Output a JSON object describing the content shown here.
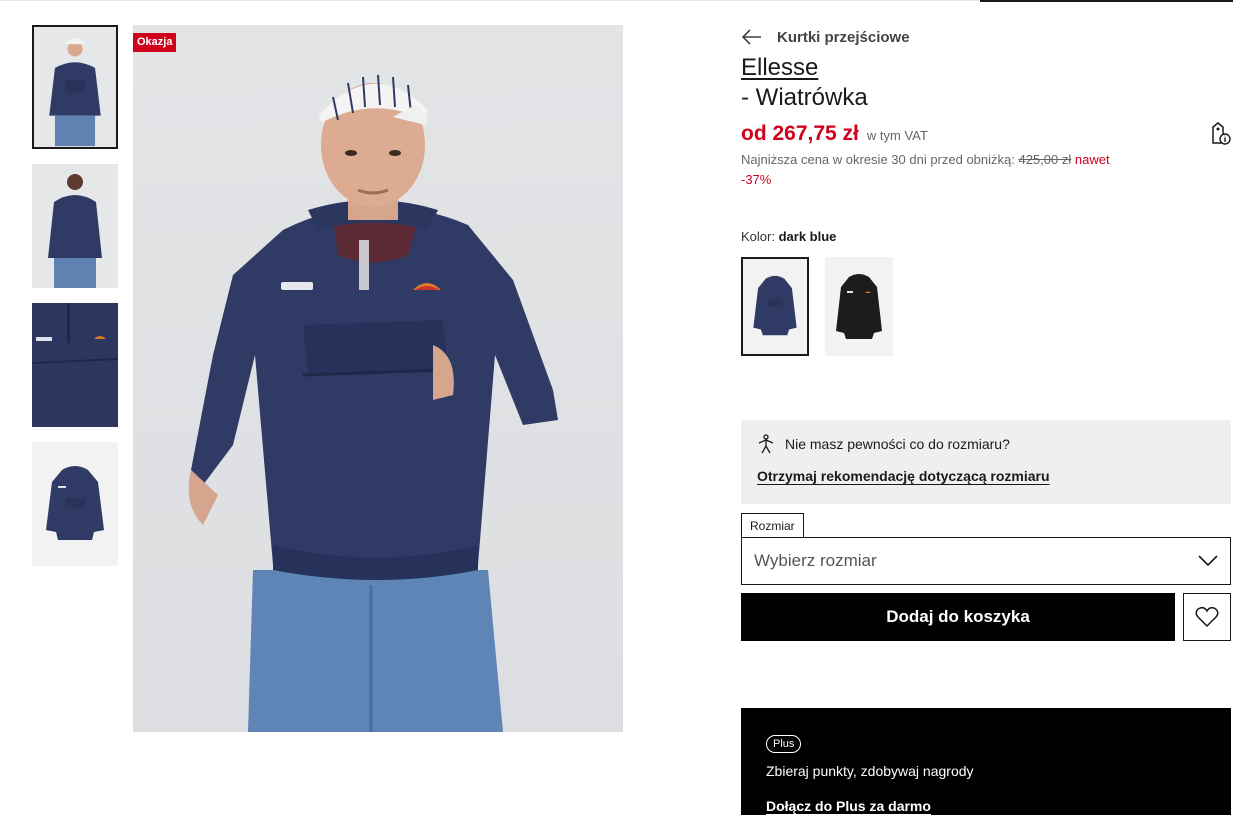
{
  "badge": "Okazja",
  "breadcrumb": {
    "label": "Kurtki przejściowe",
    "icon": "arrow-left-icon"
  },
  "product": {
    "brand": "Ellesse",
    "name": "- Wiatrówka"
  },
  "price": {
    "current": "od 267,75 zł",
    "vat_note": "w tym VAT",
    "lowest_prefix": "Najniższa cena w okresie 30 dni przed obniżką:",
    "lowest_value": "425,00 zł",
    "discount_prefix": "nawet",
    "discount": "-37%",
    "info_icon": "price-tag-info-icon"
  },
  "color": {
    "label": "Kolor:",
    "value": "dark blue",
    "options": [
      {
        "name": "dark blue",
        "hex": "#2e3a63",
        "selected": true
      },
      {
        "name": "black",
        "hex": "#1c1c1c",
        "selected": false
      }
    ]
  },
  "size_help": {
    "question": "Nie masz pewności co do rozmiaru?",
    "link": "Otrzymaj rekomendację dotyczącą rozmiaru",
    "icon": "size-figure-icon"
  },
  "size": {
    "label": "Rozmiar",
    "placeholder": "Wybierz rozmiar"
  },
  "actions": {
    "add_to_cart": "Dodaj do koszyka",
    "wishlist_icon": "heart-icon"
  },
  "plus": {
    "pill": "Plus",
    "text": "Zbieraj punkty, zdobywaj nagrody",
    "link": "Dołącz do Plus za darmo"
  },
  "colors": {
    "sale_red": "#d0021b",
    "jacket_navy": "#2e3a63",
    "button_black": "#000000"
  }
}
